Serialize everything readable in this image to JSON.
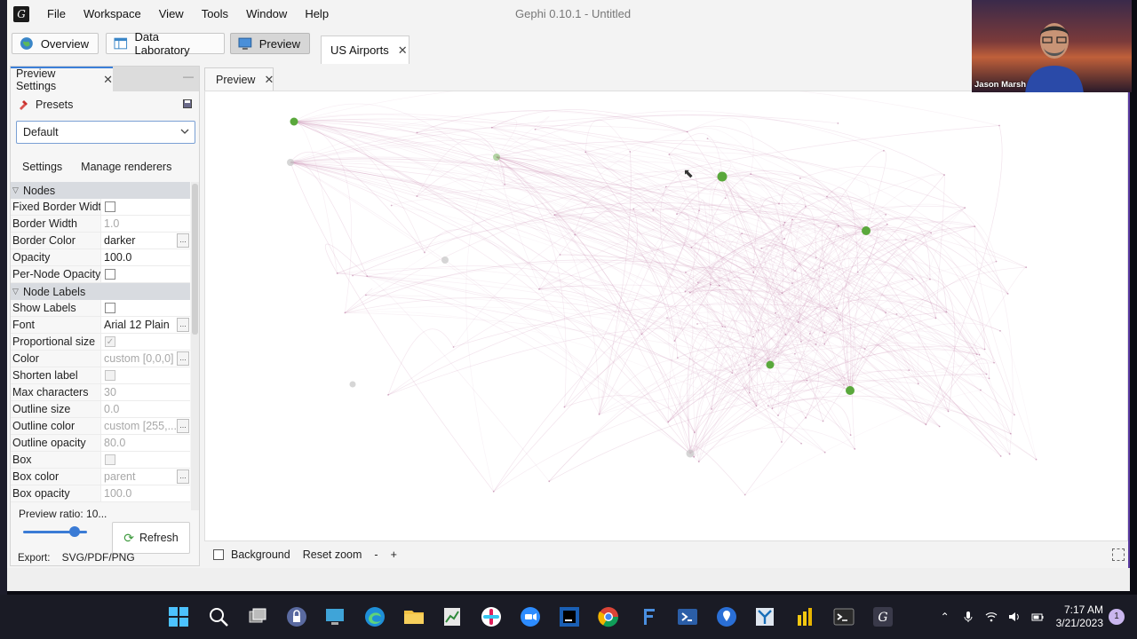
{
  "window": {
    "title": "Gephi 0.10.1 - Untitled",
    "logo_glyph": "G"
  },
  "menu": [
    "File",
    "Workspace",
    "View",
    "Tools",
    "Window",
    "Help"
  ],
  "workspaces": {
    "overview": "Overview",
    "data_laboratory": "Data Laboratory",
    "preview": "Preview",
    "active": "Preview"
  },
  "project_tab": {
    "label": "US Airports",
    "close": "✕"
  },
  "left_panel": {
    "tab_label": "Preview Settings",
    "tab_close": "✕",
    "minimize": "—",
    "presets_label": "Presets",
    "preset_selected": "Default",
    "subtabs": [
      "Settings",
      "Manage renderers"
    ],
    "categories": {
      "nodes": "Nodes",
      "node_labels": "Node Labels"
    },
    "nodes_props": [
      {
        "name": "Fixed Border Width",
        "type": "checkbox",
        "checked": false,
        "disabled": false
      },
      {
        "name": "Border Width",
        "type": "text",
        "value": "1.0",
        "disabled": true
      },
      {
        "name": "Border Color",
        "type": "text",
        "value": "darker",
        "disabled": false,
        "ellipsis": true
      },
      {
        "name": "Opacity",
        "type": "text",
        "value": "100.0",
        "disabled": false
      },
      {
        "name": "Per-Node Opacity",
        "type": "checkbox",
        "checked": false,
        "disabled": false
      }
    ],
    "label_props": [
      {
        "name": "Show Labels",
        "type": "checkbox",
        "checked": false,
        "disabled": false
      },
      {
        "name": "Font",
        "type": "text",
        "value": "Arial 12 Plain",
        "disabled": false,
        "ellipsis": true
      },
      {
        "name": "Proportional size",
        "type": "checkbox",
        "checked": true,
        "disabled": true
      },
      {
        "name": "Color",
        "type": "text",
        "value": "custom [0,0,0]",
        "disabled": true,
        "ellipsis": true
      },
      {
        "name": "Shorten label",
        "type": "checkbox",
        "checked": false,
        "disabled": true
      },
      {
        "name": "Max characters",
        "type": "text",
        "value": "30",
        "disabled": true
      },
      {
        "name": "Outline size",
        "type": "text",
        "value": "0.0",
        "disabled": true
      },
      {
        "name": "Outline color",
        "type": "text",
        "value": "custom [255,...",
        "disabled": true,
        "ellipsis": true
      },
      {
        "name": "Outline opacity",
        "type": "text",
        "value": "80.0",
        "disabled": true
      },
      {
        "name": "Box",
        "type": "checkbox",
        "checked": false,
        "disabled": true
      },
      {
        "name": "Box color",
        "type": "text",
        "value": "parent",
        "disabled": true,
        "ellipsis": true
      },
      {
        "name": "Box opacity",
        "type": "text",
        "value": "100.0",
        "disabled": true
      }
    ],
    "ellipsis_glyph": "...",
    "preview_ratio_label": "Preview ratio: 10...",
    "preview_ratio_fraction": 0.8,
    "refresh_label": "Refresh",
    "export_label": "Export:",
    "export_value": "SVG/PDF/PNG"
  },
  "preview": {
    "tab_label": "Preview",
    "tab_close": "✕",
    "background_label": "Background",
    "reset_zoom_label": "Reset zoom",
    "zoom_out": "-",
    "zoom_in": "+",
    "colors": {
      "edge": "#c98ab0",
      "node_green": "#5aa83c",
      "node_gray": "#c4c4c4"
    }
  },
  "webcam": {
    "name": "Jason Marsh"
  },
  "taskbar": {
    "time": "7:17 AM",
    "date": "3/21/2023",
    "notifications": "1"
  }
}
